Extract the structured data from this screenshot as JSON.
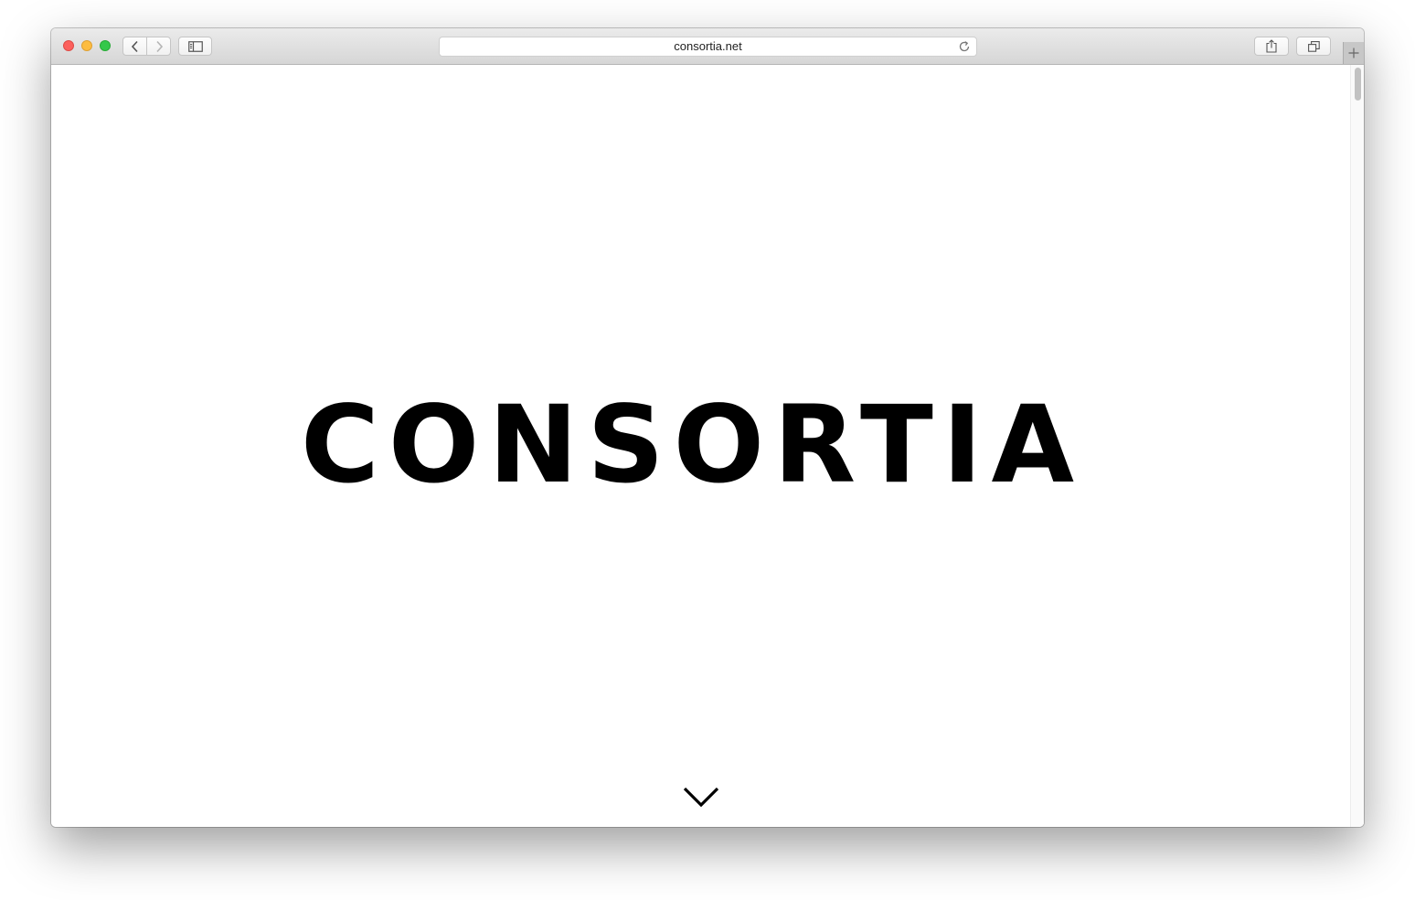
{
  "browser": {
    "address": "consortia.net",
    "icons": {
      "back": "chevron-left-icon",
      "forward": "chevron-right-icon",
      "sidebar": "sidebar-icon",
      "reload": "reload-icon",
      "share": "share-icon",
      "tabs": "tabs-overview-icon",
      "new_tab": "plus-icon"
    }
  },
  "page": {
    "logo_text": "CONSORTIA",
    "scroll_indicator": "chevron-down-icon"
  },
  "colors": {
    "close": "#fc605c",
    "minimize": "#fdbc40",
    "maximize": "#34c84a",
    "logo": "#000000"
  }
}
